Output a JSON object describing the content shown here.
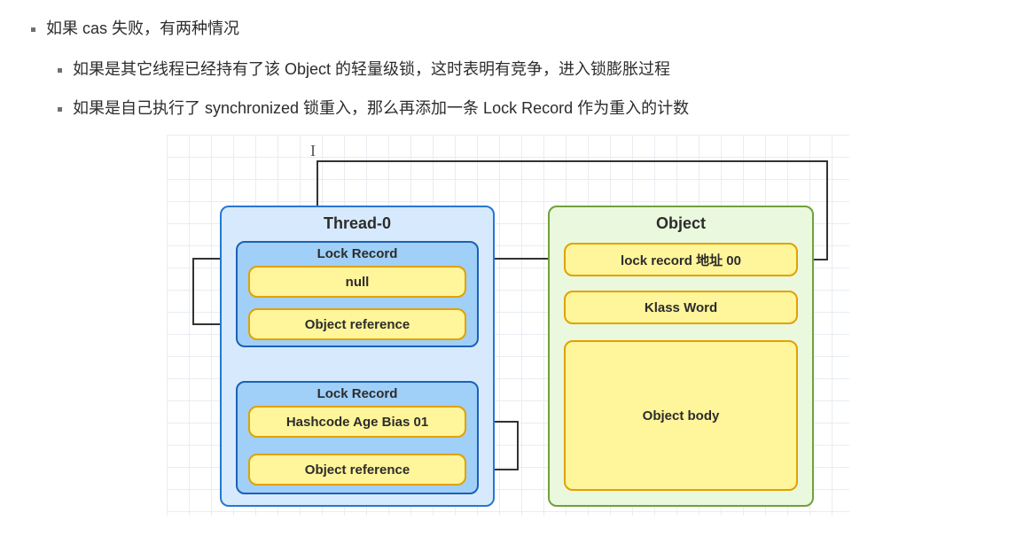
{
  "bullets": {
    "b1": "如果 cas 失败，有两种情况",
    "b2": "如果是其它线程已经持有了该 Object 的轻量级锁，这时表明有竞争，进入锁膨胀过程",
    "b3": "如果是自己执行了 synchronized 锁重入，那么再添加一条 Lock Record 作为重入的计数"
  },
  "diagram": {
    "thread": {
      "title": "Thread-0",
      "lockRecord1": {
        "title": "Lock Record",
        "slot1": "null",
        "slot2": "Object reference"
      },
      "lockRecord2": {
        "title": "Lock Record",
        "slot1": "Hashcode Age Bias 01",
        "slot2": "Object reference"
      }
    },
    "object": {
      "title": "Object",
      "markword": "lock record 地址 00",
      "klass": "Klass Word",
      "body": "Object body"
    }
  }
}
